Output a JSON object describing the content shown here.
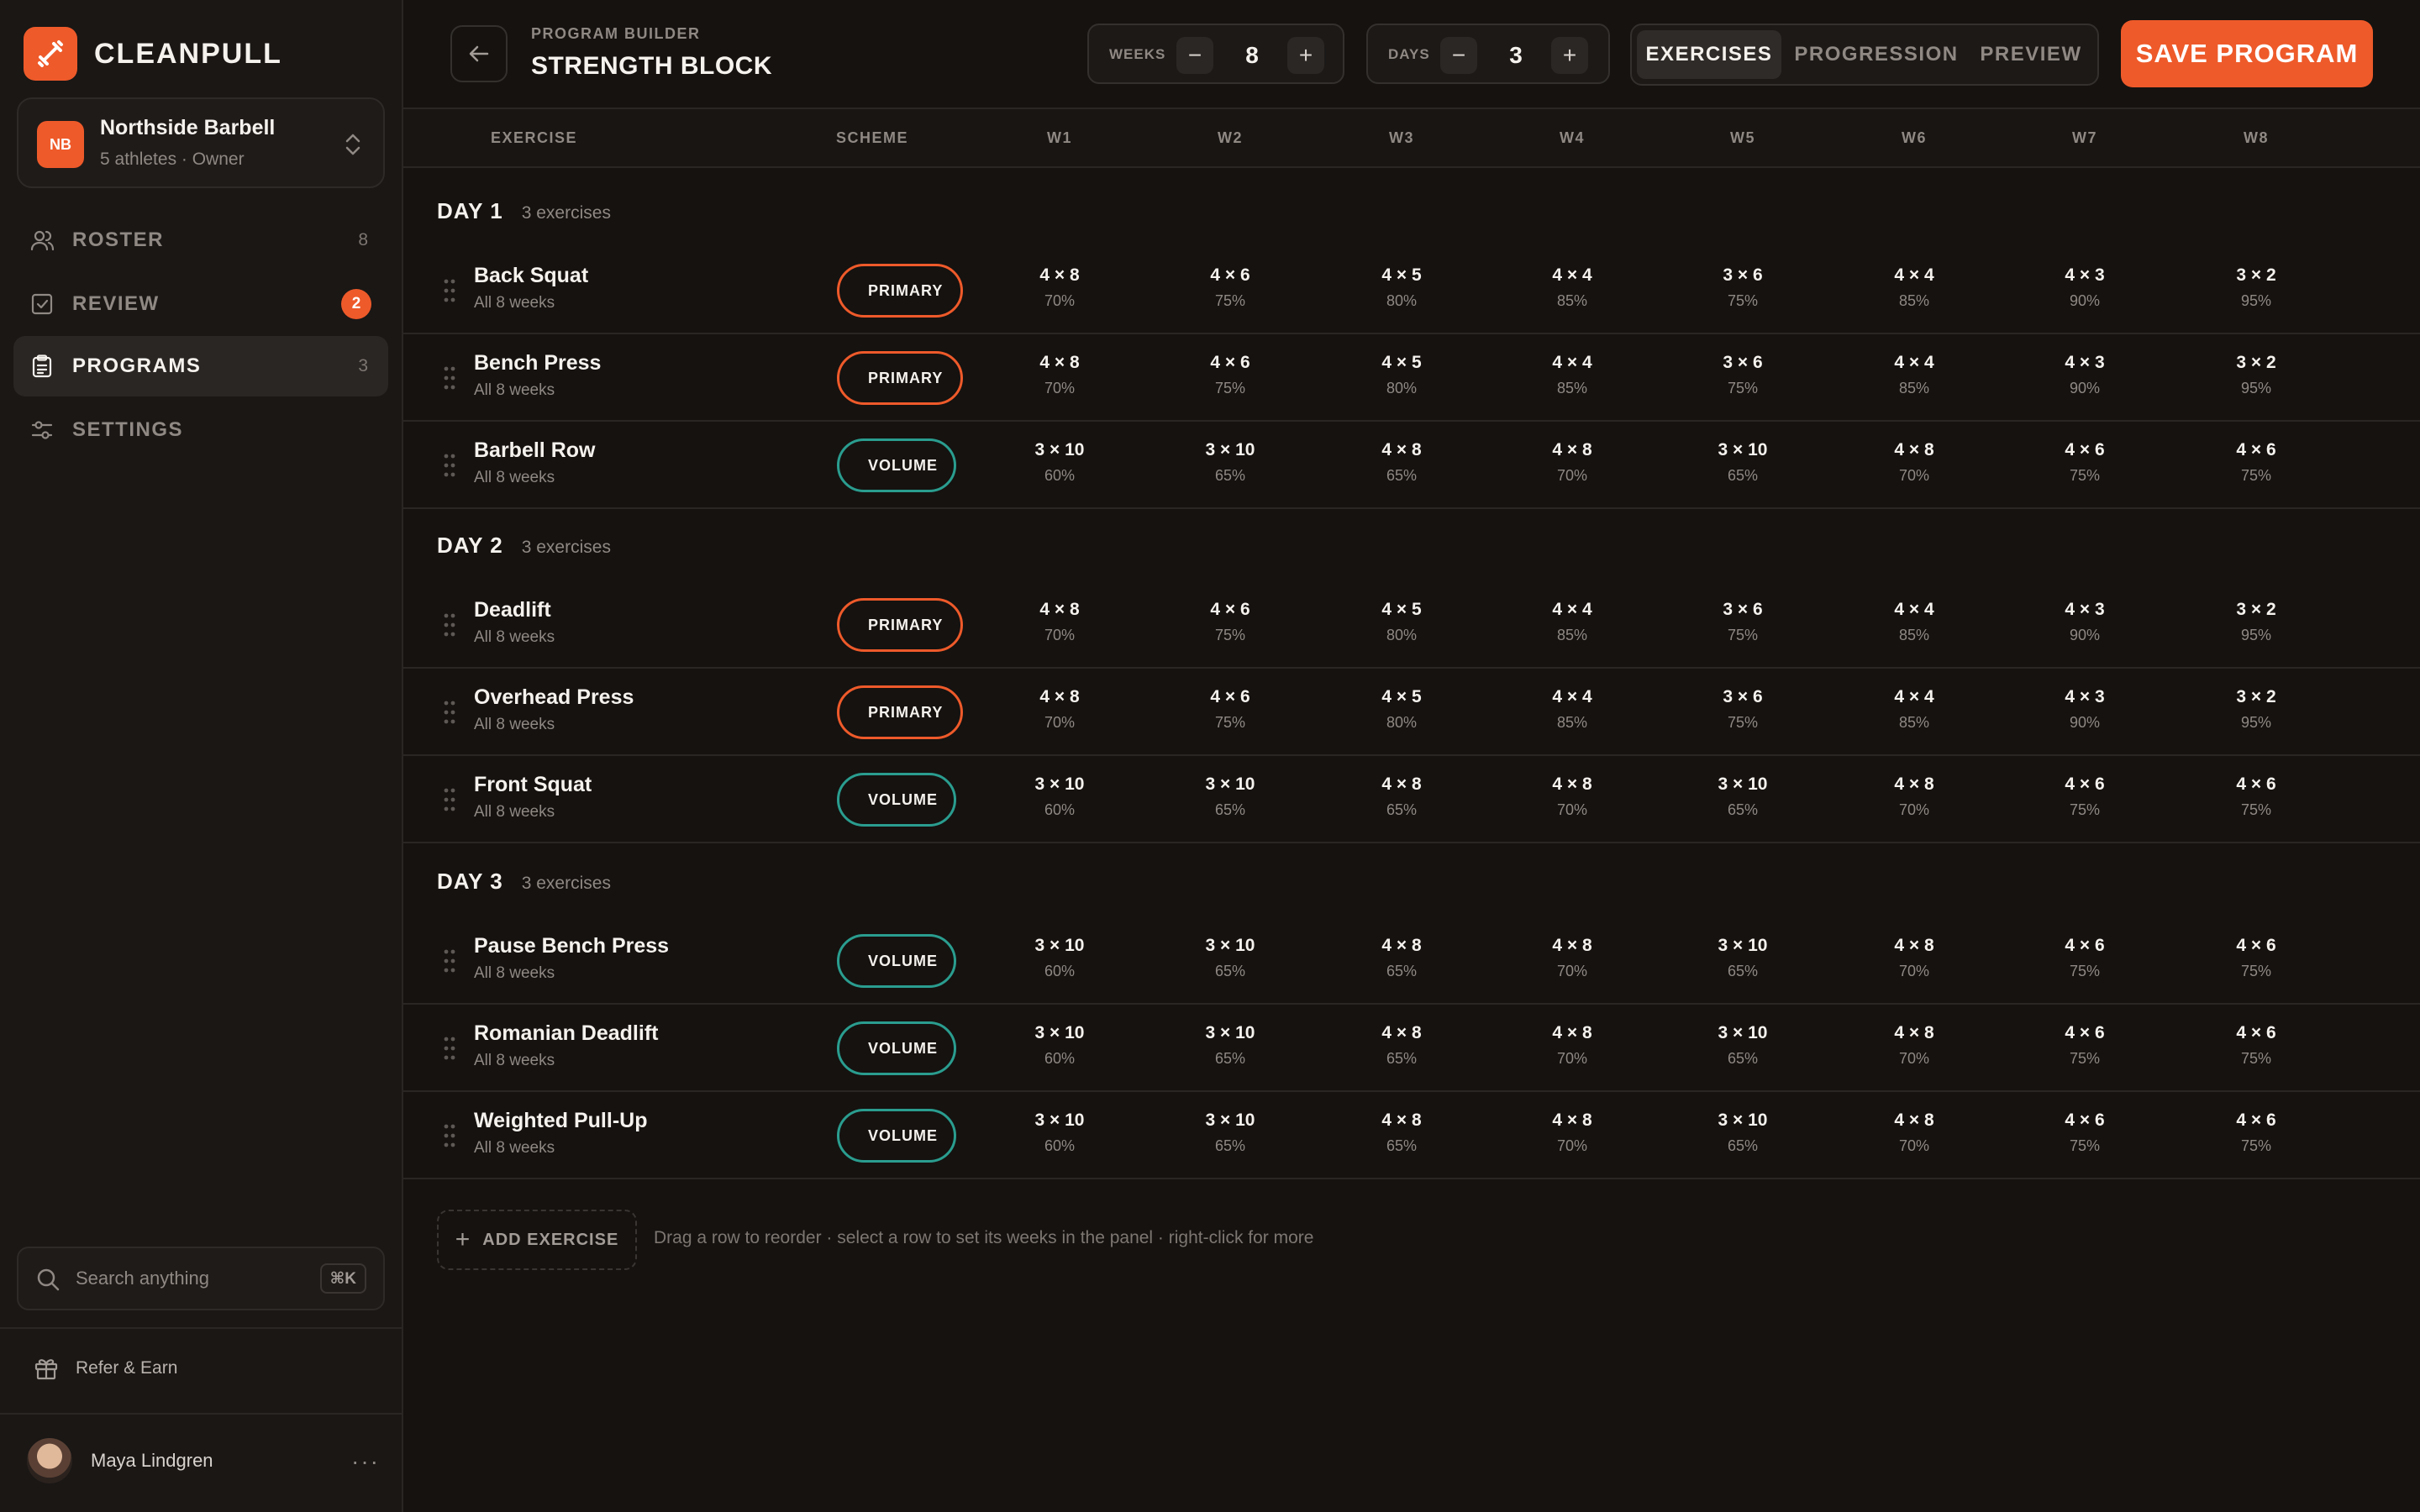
{
  "app": {
    "name": "CLEANPULL",
    "accent": "#ee5a2a",
    "volume_color": "#2a9d8f"
  },
  "org": {
    "initials": "NB",
    "name": "Northside Barbell",
    "meta": "5 athletes · Owner"
  },
  "nav": [
    {
      "label": "ROSTER",
      "count": "8",
      "icon": "users-icon"
    },
    {
      "label": "REVIEW",
      "badge": "2",
      "icon": "check-square-icon"
    },
    {
      "label": "PROGRAMS",
      "count": "3",
      "icon": "clipboard-icon",
      "active": true
    },
    {
      "label": "SETTINGS",
      "icon": "sliders-icon"
    }
  ],
  "search": {
    "placeholder": "Search anything",
    "shortcut": "⌘K"
  },
  "refer": {
    "label": "Refer & Earn"
  },
  "user": {
    "name": "Maya Lindgren",
    "more": "···"
  },
  "header": {
    "crumb": "PROGRAM BUILDER",
    "title": "STRENGTH BLOCK",
    "weeks": {
      "label": "WEEKS",
      "value": "8",
      "minus": "−",
      "plus": "+"
    },
    "days": {
      "label": "DAYS",
      "value": "3",
      "minus": "−",
      "plus": "+"
    },
    "tabs": [
      {
        "label": "EXERCISES",
        "active": true
      },
      {
        "label": "PROGRESSION"
      },
      {
        "label": "PREVIEW"
      }
    ],
    "save_label": "SAVE PROGRAM"
  },
  "table": {
    "columns": {
      "exercise": "EXERCISE",
      "scheme": "SCHEME",
      "weeks": [
        "W1",
        "W2",
        "W3",
        "W4",
        "W5",
        "W6",
        "W7",
        "W8"
      ]
    },
    "days": [
      {
        "label": "DAY 1",
        "count": "3 exercises",
        "rows": [
          {
            "name": "Back Squat",
            "sub": "All 8 weeks",
            "scheme": "PRIMARY",
            "type": "primary",
            "cells": [
              [
                "4 × 8",
                "70%"
              ],
              [
                "4 × 6",
                "75%"
              ],
              [
                "4 × 5",
                "80%"
              ],
              [
                "4 × 4",
                "85%"
              ],
              [
                "3 × 6",
                "75%"
              ],
              [
                "4 × 4",
                "85%"
              ],
              [
                "4 × 3",
                "90%"
              ],
              [
                "3 × 2",
                "95%"
              ]
            ]
          },
          {
            "name": "Bench Press",
            "sub": "All 8 weeks",
            "scheme": "PRIMARY",
            "type": "primary",
            "cells": [
              [
                "4 × 8",
                "70%"
              ],
              [
                "4 × 6",
                "75%"
              ],
              [
                "4 × 5",
                "80%"
              ],
              [
                "4 × 4",
                "85%"
              ],
              [
                "3 × 6",
                "75%"
              ],
              [
                "4 × 4",
                "85%"
              ],
              [
                "4 × 3",
                "90%"
              ],
              [
                "3 × 2",
                "95%"
              ]
            ]
          },
          {
            "name": "Barbell Row",
            "sub": "All 8 weeks",
            "scheme": "VOLUME",
            "type": "volume",
            "cells": [
              [
                "3 × 10",
                "60%"
              ],
              [
                "3 × 10",
                "65%"
              ],
              [
                "4 × 8",
                "65%"
              ],
              [
                "4 × 8",
                "70%"
              ],
              [
                "3 × 10",
                "65%"
              ],
              [
                "4 × 8",
                "70%"
              ],
              [
                "4 × 6",
                "75%"
              ],
              [
                "4 × 6",
                "75%"
              ]
            ]
          }
        ]
      },
      {
        "label": "DAY 2",
        "count": "3 exercises",
        "rows": [
          {
            "name": "Deadlift",
            "sub": "All 8 weeks",
            "scheme": "PRIMARY",
            "type": "primary",
            "cells": [
              [
                "4 × 8",
                "70%"
              ],
              [
                "4 × 6",
                "75%"
              ],
              [
                "4 × 5",
                "80%"
              ],
              [
                "4 × 4",
                "85%"
              ],
              [
                "3 × 6",
                "75%"
              ],
              [
                "4 × 4",
                "85%"
              ],
              [
                "4 × 3",
                "90%"
              ],
              [
                "3 × 2",
                "95%"
              ]
            ]
          },
          {
            "name": "Overhead Press",
            "sub": "All 8 weeks",
            "scheme": "PRIMARY",
            "type": "primary",
            "cells": [
              [
                "4 × 8",
                "70%"
              ],
              [
                "4 × 6",
                "75%"
              ],
              [
                "4 × 5",
                "80%"
              ],
              [
                "4 × 4",
                "85%"
              ],
              [
                "3 × 6",
                "75%"
              ],
              [
                "4 × 4",
                "85%"
              ],
              [
                "4 × 3",
                "90%"
              ],
              [
                "3 × 2",
                "95%"
              ]
            ]
          },
          {
            "name": "Front Squat",
            "sub": "All 8 weeks",
            "scheme": "VOLUME",
            "type": "volume",
            "cells": [
              [
                "3 × 10",
                "60%"
              ],
              [
                "3 × 10",
                "65%"
              ],
              [
                "4 × 8",
                "65%"
              ],
              [
                "4 × 8",
                "70%"
              ],
              [
                "3 × 10",
                "65%"
              ],
              [
                "4 × 8",
                "70%"
              ],
              [
                "4 × 6",
                "75%"
              ],
              [
                "4 × 6",
                "75%"
              ]
            ]
          }
        ]
      },
      {
        "label": "DAY 3",
        "count": "3 exercises",
        "rows": [
          {
            "name": "Pause Bench Press",
            "sub": "All 8 weeks",
            "scheme": "VOLUME",
            "type": "volume",
            "cells": [
              [
                "3 × 10",
                "60%"
              ],
              [
                "3 × 10",
                "65%"
              ],
              [
                "4 × 8",
                "65%"
              ],
              [
                "4 × 8",
                "70%"
              ],
              [
                "3 × 10",
                "65%"
              ],
              [
                "4 × 8",
                "70%"
              ],
              [
                "4 × 6",
                "75%"
              ],
              [
                "4 × 6",
                "75%"
              ]
            ]
          },
          {
            "name": "Romanian Deadlift",
            "sub": "All 8 weeks",
            "scheme": "VOLUME",
            "type": "volume",
            "cells": [
              [
                "3 × 10",
                "60%"
              ],
              [
                "3 × 10",
                "65%"
              ],
              [
                "4 × 8",
                "65%"
              ],
              [
                "4 × 8",
                "70%"
              ],
              [
                "3 × 10",
                "65%"
              ],
              [
                "4 × 8",
                "70%"
              ],
              [
                "4 × 6",
                "75%"
              ],
              [
                "4 × 6",
                "75%"
              ]
            ]
          },
          {
            "name": "Weighted Pull-Up",
            "sub": "All 8 weeks",
            "scheme": "VOLUME",
            "type": "volume",
            "cells": [
              [
                "3 × 10",
                "60%"
              ],
              [
                "3 × 10",
                "65%"
              ],
              [
                "4 × 8",
                "65%"
              ],
              [
                "4 × 8",
                "70%"
              ],
              [
                "3 × 10",
                "65%"
              ],
              [
                "4 × 8",
                "70%"
              ],
              [
                "4 × 6",
                "75%"
              ],
              [
                "4 × 6",
                "75%"
              ]
            ]
          }
        ]
      }
    ]
  },
  "footer": {
    "add_label": "ADD EXERCISE",
    "add_plus": "+",
    "hint": "Drag a row to reorder · select a row to set its weeks in the panel · right-click for more"
  }
}
